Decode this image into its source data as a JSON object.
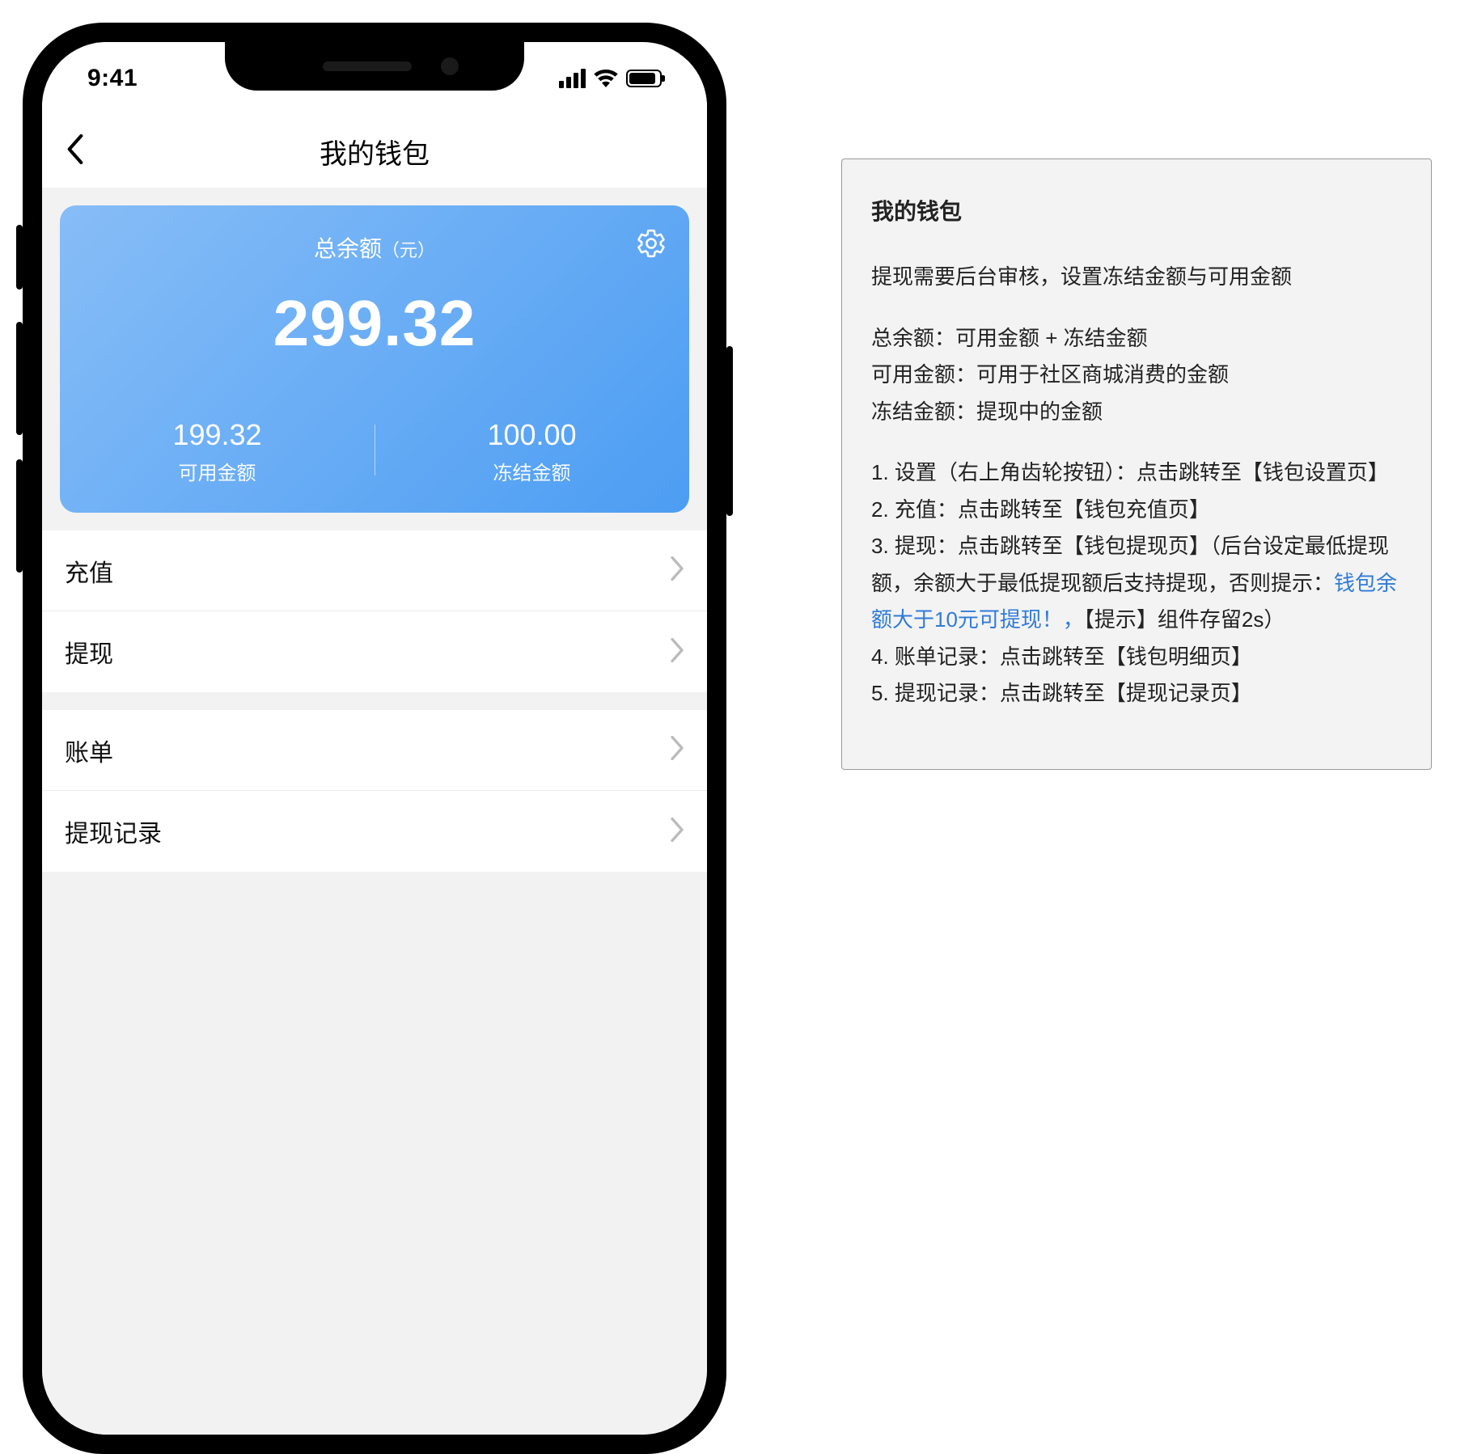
{
  "status": {
    "time": "9:41"
  },
  "nav": {
    "title": "我的钱包"
  },
  "card": {
    "label": "总余额",
    "unit": "（元）",
    "total": "299.32",
    "available_value": "199.32",
    "available_label": "可用金额",
    "frozen_value": "100.00",
    "frozen_label": "冻结金额"
  },
  "menu1": [
    {
      "label": "充值"
    },
    {
      "label": "提现"
    }
  ],
  "menu2": [
    {
      "label": "账单"
    },
    {
      "label": "提现记录"
    }
  ],
  "ann": {
    "title": "我的钱包",
    "p1": "提现需要后台审核，设置冻结金额与可用金额",
    "defs": [
      "总余额：可用金额 + 冻结金额",
      "可用金额：可用于社区商城消费的金额",
      "冻结金额：提现中的金额"
    ],
    "steps_a": "1. 设置（右上角齿轮按钮）：点击跳转至【钱包设置页】",
    "steps_b": "2. 充值：点击跳转至【钱包充值页】",
    "steps_c_pre": "3. 提现：点击跳转至【钱包提现页】（后台设定最低提现额，余额大于最低提现额后支持提现，否则提示：",
    "steps_c_link": "钱包余额大于10元可提现！，",
    "steps_c_post": "【提示】组件存留2s）",
    "steps_d": "4. 账单记录：点击跳转至【钱包明细页】",
    "steps_e": "5. 提现记录：点击跳转至【提现记录页】"
  }
}
